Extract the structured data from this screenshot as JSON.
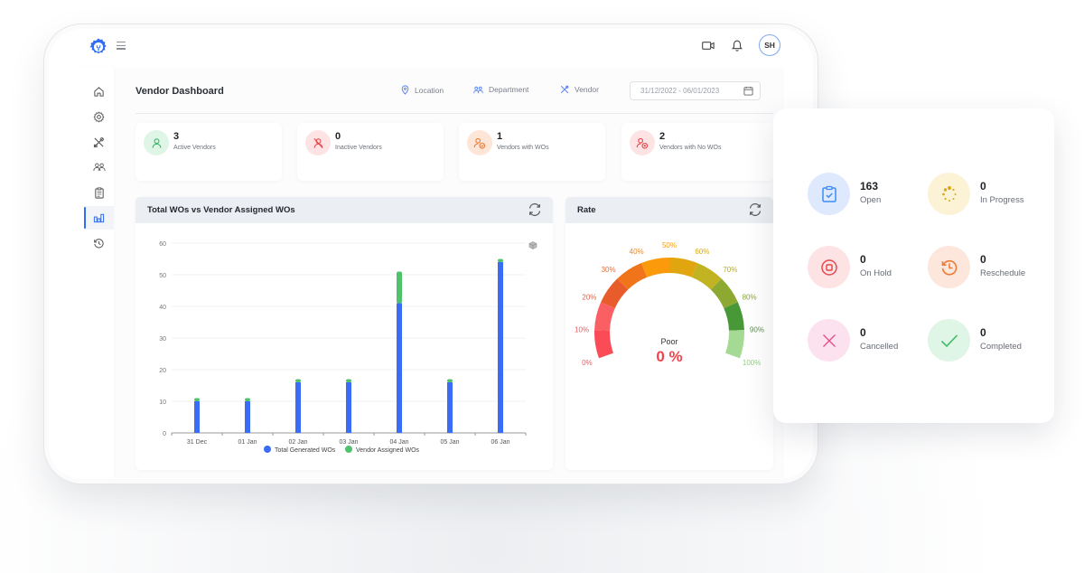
{
  "header": {
    "avatar_initials": "SH",
    "icons": [
      "logo-gear-wrench-icon",
      "hamburger-menu-icon",
      "video-camera-icon",
      "bell-icon"
    ]
  },
  "sidebar": {
    "items": [
      {
        "name": "home",
        "icon": "home-icon",
        "active": false
      },
      {
        "name": "settings",
        "icon": "gear-icon",
        "active": false
      },
      {
        "name": "tools",
        "icon": "tools-icon",
        "active": false
      },
      {
        "name": "vendors",
        "icon": "users-group-icon",
        "active": false
      },
      {
        "name": "work-orders",
        "icon": "clipboard-icon",
        "active": false
      },
      {
        "name": "reports",
        "icon": "bar-chart-icon",
        "active": true
      },
      {
        "name": "history",
        "icon": "history-icon",
        "active": false
      }
    ]
  },
  "page": {
    "title": "Vendor Dashboard",
    "filters": {
      "location": "Location",
      "department": "Department",
      "vendor": "Vendor",
      "date_range": "31/12/2022 - 06/01/2023"
    }
  },
  "stats": [
    {
      "value": "3",
      "label": "Active Vendors",
      "icon": "user-icon",
      "color": "#3bb56b",
      "bg": "#dff5e6"
    },
    {
      "value": "0",
      "label": "Inactive Vendors",
      "icon": "user-slash-icon",
      "color": "#e5484d",
      "bg": "#fde3e3"
    },
    {
      "value": "1",
      "label": "Vendors with WOs",
      "icon": "user-check-icon",
      "color": "#ef7a35",
      "bg": "#fde6d8"
    },
    {
      "value": "2",
      "label": "Vendors with No WOs",
      "icon": "user-cancel-icon",
      "color": "#e5484d",
      "bg": "#fde3e3"
    }
  ],
  "bar_panel": {
    "title": "Total WOs vs Vendor Assigned WOs"
  },
  "rate_panel": {
    "title": "Rate",
    "status_text": "Poor",
    "value_text": "0 %"
  },
  "chart_data": [
    {
      "type": "bar",
      "stacked": true,
      "title": "Total WOs vs Vendor Assigned WOs",
      "categories": [
        "31 Dec",
        "01 Jan",
        "02 Jan",
        "03 Jan",
        "04 Jan",
        "05 Jan",
        "06 Jan"
      ],
      "series": [
        {
          "name": "Total Generated WOs",
          "color": "#3b6cf6",
          "values": [
            10,
            10,
            16,
            16,
            41,
            16,
            54
          ]
        },
        {
          "name": "Vendor Assigned WOs",
          "color": "#4fc36c",
          "values": [
            1,
            1,
            1,
            1,
            10,
            1,
            1
          ]
        }
      ],
      "ylim": [
        0,
        60
      ],
      "yticks": [
        0,
        10,
        20,
        30,
        40,
        50,
        60
      ],
      "grid": true,
      "legend": "bottom"
    },
    {
      "type": "gauge",
      "title": "Rate",
      "value": 0,
      "range": [
        0,
        100
      ],
      "tick_labels": [
        "0%",
        "10%",
        "20%",
        "30%",
        "40%",
        "50%",
        "60%",
        "70%",
        "80%",
        "90%",
        "100%"
      ],
      "band_colors": [
        "#fa4b56",
        "#fa5f64",
        "#e85c2c",
        "#f0751a",
        "#fb9a0b",
        "#e1a60f",
        "#c2b322",
        "#8ea932",
        "#489838",
        "#a5da94"
      ],
      "label_colors": [
        "#f05a60",
        "#f05a60",
        "#ec5b3a",
        "#ee6a2a",
        "#f0861c",
        "#f2a012",
        "#d8a817",
        "#b4ad26",
        "#88a734",
        "#4d9a3c",
        "#8fd27e"
      ],
      "status": "Poor",
      "display": "0 %"
    }
  ],
  "status_overview": [
    {
      "value": "163",
      "label": "Open",
      "icon": "clipboard-check-icon",
      "color": "#3b8df5",
      "bg": "#dfe9fd"
    },
    {
      "value": "0",
      "label": "In Progress",
      "icon": "spinner-icon",
      "color": "#d9a915",
      "bg": "#fcf3d7"
    },
    {
      "value": "0",
      "label": "On Hold",
      "icon": "stop-circle-icon",
      "color": "#e5484d",
      "bg": "#fde3e3"
    },
    {
      "value": "0",
      "label": "Reschedule",
      "icon": "clock-rewind-icon",
      "color": "#ef7a35",
      "bg": "#fde6dc"
    },
    {
      "value": "0",
      "label": "Cancelled",
      "icon": "x-icon",
      "color": "#e3508a",
      "bg": "#fbe2ee"
    },
    {
      "value": "0",
      "label": "Completed",
      "icon": "check-icon",
      "color": "#3fbd63",
      "bg": "#dff5e6"
    }
  ]
}
